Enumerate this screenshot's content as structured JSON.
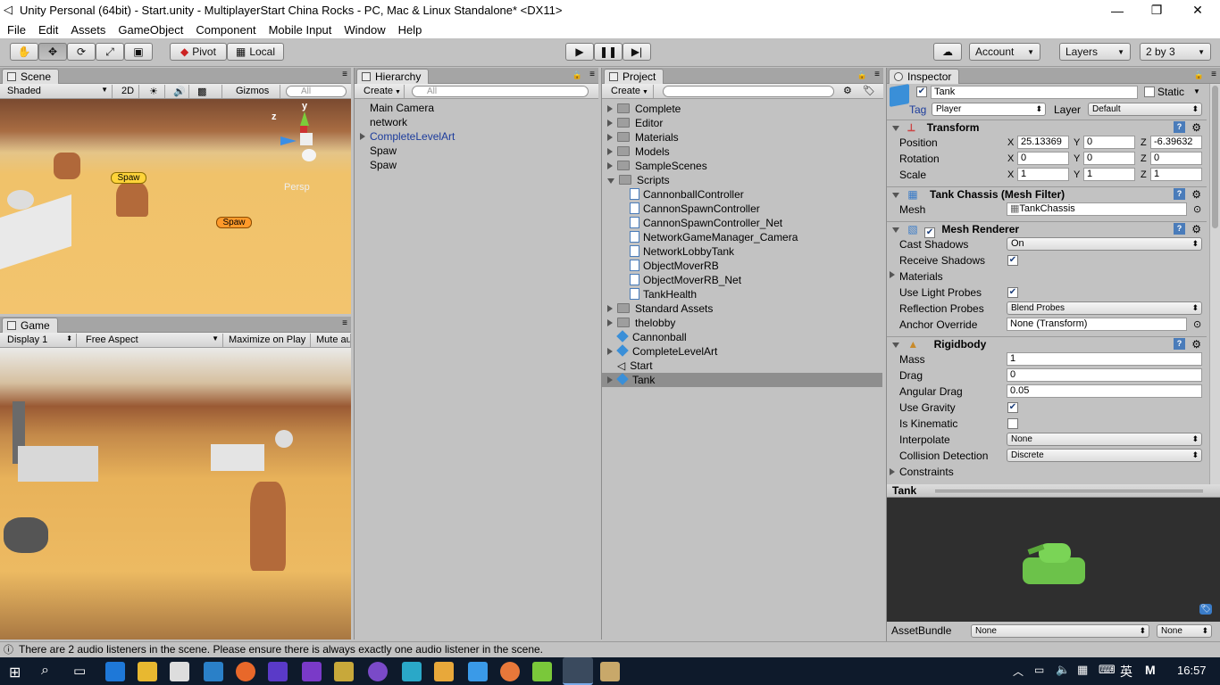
{
  "window": {
    "title": "Unity Personal (64bit) - Start.unity - MultiplayerStart China Rocks - PC, Mac & Linux Standalone* <DX11>"
  },
  "menu": [
    "File",
    "Edit",
    "Assets",
    "GameObject",
    "Component",
    "Mobile Input",
    "Window",
    "Help"
  ],
  "toolbar": {
    "pivot": "Pivot",
    "local": "Local",
    "account": "Account",
    "layers": "Layers",
    "layout": "2 by 3"
  },
  "scene": {
    "tab": "Scene",
    "shading": "Shaded",
    "mode2d": "2D",
    "gizmos": "Gizmos",
    "search_placeholder": "All",
    "persp": "Persp",
    "spawn1": "Spaw",
    "spawn2": "Spaw",
    "axis_y": "y",
    "axis_z": "z"
  },
  "game": {
    "tab": "Game",
    "display": "Display 1",
    "aspect": "Free Aspect",
    "maximize": "Maximize on Play",
    "mute": "Mute au"
  },
  "hierarchy": {
    "tab": "Hierarchy",
    "create": "Create",
    "search_placeholder": "All",
    "items": [
      "Main Camera",
      "network",
      "CompleteLevelArt",
      "Spaw",
      "Spaw"
    ]
  },
  "project": {
    "tab": "Project",
    "create": "Create",
    "folders": [
      "Complete",
      "Editor",
      "Materials",
      "Models",
      "SampleScenes",
      "Scripts"
    ],
    "scripts": [
      "CannonballController",
      "CannonSpawnController",
      "CannonSpawnController_Net",
      "NetworkGameManager_Camera",
      "NetworkLobbyTank",
      "ObjectMoverRB",
      "ObjectMoverRB_Net",
      "TankHealth"
    ],
    "after_folders": [
      "Standard Assets",
      "thelobby"
    ],
    "assets": [
      "Cannonball",
      "CompleteLevelArt",
      "Start",
      "Tank"
    ]
  },
  "inspector": {
    "tab": "Inspector",
    "name": "Tank",
    "static": "Static",
    "tag_label": "Tag",
    "tag": "Player",
    "layer_label": "Layer",
    "layer": "Default",
    "transform": {
      "title": "Transform",
      "position_label": "Position",
      "rotation_label": "Rotation",
      "scale_label": "Scale",
      "position": [
        "25.13369",
        "0",
        "-6.39632"
      ],
      "rotation": [
        "0",
        "0",
        "0"
      ],
      "scale": [
        "1",
        "1",
        "1"
      ]
    },
    "meshfilter": {
      "title": "Tank Chassis (Mesh Filter)",
      "mesh_label": "Mesh",
      "mesh": "TankChassis"
    },
    "meshrenderer": {
      "title": "Mesh Renderer",
      "cast_label": "Cast Shadows",
      "cast": "On",
      "receive_label": "Receive Shadows",
      "materials_label": "Materials",
      "lightprobes_label": "Use Light Probes",
      "reflection_label": "Reflection Probes",
      "reflection": "Blend Probes",
      "anchor_label": "Anchor Override",
      "anchor": "None (Transform)"
    },
    "rigidbody": {
      "title": "Rigidbody",
      "mass_label": "Mass",
      "mass": "1",
      "drag_label": "Drag",
      "drag": "0",
      "angular_label": "Angular Drag",
      "angular": "0.05",
      "gravity_label": "Use Gravity",
      "kinematic_label": "Is Kinematic",
      "interpolate_label": "Interpolate",
      "interpolate": "None",
      "collision_label": "Collision Detection",
      "collision": "Discrete",
      "constraints_label": "Constraints"
    },
    "preview": {
      "title": "Tank",
      "assetbundle_label": "AssetBundle",
      "bundle": "None",
      "variant": "None"
    }
  },
  "status": {
    "message": "There are 2 audio listeners in the scene. Please ensure there is always exactly one audio listener in the scene."
  },
  "taskbar": {
    "ime": "英",
    "ime2": "M",
    "time": "16:57"
  }
}
